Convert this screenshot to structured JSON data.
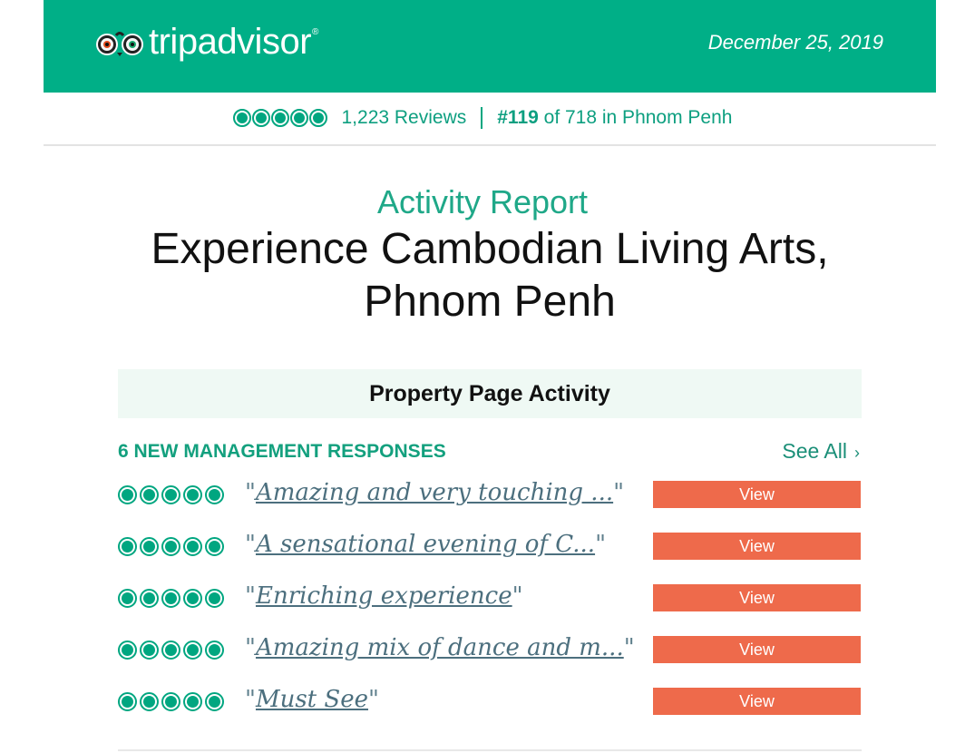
{
  "header": {
    "brand": "tripadvisor",
    "registered_mark": "®",
    "date": "December 25, 2019",
    "background_color": "#00af87"
  },
  "stats": {
    "rating_bubbles": 5,
    "reviews": "1,223 Reviews",
    "rank": "#119",
    "rank_suffix": "of 718 in Phnom Penh"
  },
  "report": {
    "label": "Activity Report",
    "title": "Experience Cambodian Living Arts, Phnom Penh"
  },
  "section": {
    "title": "Property Page Activity"
  },
  "responses": {
    "heading": "6 NEW MANAGEMENT RESPONSES",
    "see_all": "See All",
    "see_all_icon": "chevron-right-icon",
    "items": [
      {
        "rating": 5,
        "title": "Amazing and very touching ...",
        "button": "View"
      },
      {
        "rating": 5,
        "title": "A sensational evening of C...",
        "button": "View"
      },
      {
        "rating": 5,
        "title": "Enriching experience",
        "button": "View"
      },
      {
        "rating": 5,
        "title": "Amazing mix of dance and m...",
        "button": "View"
      },
      {
        "rating": 5,
        "title": "Must See",
        "button": "View"
      }
    ]
  },
  "colors": {
    "accent_green": "#00a680",
    "button_orange": "#ee6a4b",
    "section_bg": "#eff9f4"
  }
}
